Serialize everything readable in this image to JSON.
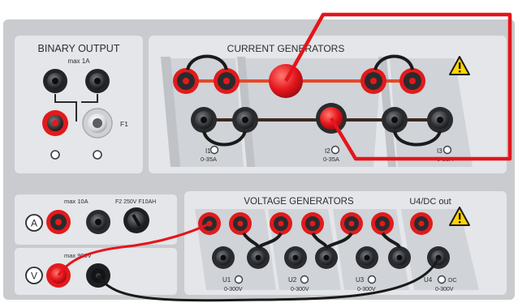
{
  "colors": {
    "outer_panel": "#c9cbce",
    "box": "#e4e6e9",
    "insert": "#d0d3d7",
    "red": "#e21a1c",
    "black_jack": "#2a2b2e",
    "cable_red": "#e4151c",
    "cable_black": "#1a1a1a",
    "warning_yellow": "#ffd400"
  },
  "binary_output": {
    "title": "BINARY OUTPUT",
    "rating": "max  1A",
    "fuse": "F1"
  },
  "current_generators": {
    "title": "CURRENT GENERATORS",
    "warning_icon": "warning-triangle-icon",
    "outputs": [
      {
        "name": "I1",
        "range": "0-35A"
      },
      {
        "name": "I2",
        "range": "0-35A"
      },
      {
        "name": "I3",
        "range": "0-35A"
      }
    ]
  },
  "aux_input": {
    "current_symbol": "A",
    "current_rating": "max  10A",
    "fuse": "F2  250V  F10AH",
    "voltage_symbol": "V",
    "voltage_rating": "max  900V"
  },
  "voltage_generators": {
    "title": "VOLTAGE GENERATORS",
    "dc_title": "U4/DC out",
    "warning_icon": "warning-triangle-icon",
    "outputs": [
      {
        "name": "U1",
        "range": "0-300V"
      },
      {
        "name": "U2",
        "range": "0-300V"
      },
      {
        "name": "U3",
        "range": "0-300V"
      },
      {
        "name": "U4",
        "extra": "DC",
        "range": "0-300V"
      }
    ]
  }
}
